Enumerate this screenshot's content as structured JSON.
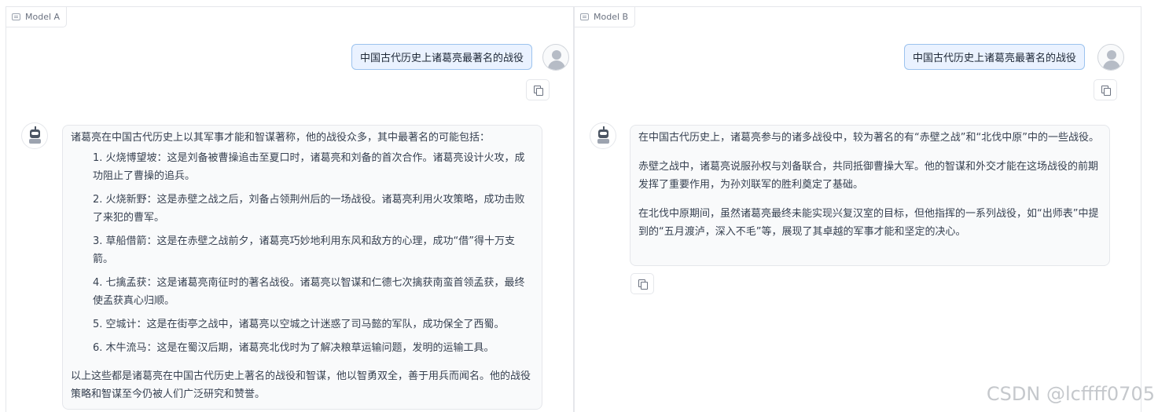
{
  "model_a": {
    "tab_label": "Model A",
    "user_message": "中国古代历史上诸葛亮最著名的战役",
    "bot_intro": "诸葛亮在中国古代历史上以其军事才能和智谋著称，他的战役众多，其中最著名的可能包括：",
    "bot_list": [
      "1. 火烧博望坡：这是刘备被曹操追击至夏口时，诸葛亮和刘备的首次合作。诸葛亮设计火攻，成功阻止了曹操的追兵。",
      "2. 火烧新野：这是赤壁之战之后，刘备占领荆州后的一场战役。诸葛亮利用火攻策略，成功击败了来犯的曹军。",
      "3. 草船借箭：这是在赤壁之战前夕，诸葛亮巧妙地利用东风和敌方的心理，成功“借”得十万支箭。",
      "4. 七擒孟获：这是诸葛亮南征时的著名战役。诸葛亮以智谋和仁德七次擒获南蛮首领孟获，最终使孟获真心归顺。",
      "5. 空城计：这是在街亭之战中，诸葛亮以空城之计迷惑了司马懿的军队，成功保全了西蜀。",
      "6. 木牛流马：这是在蜀汉后期，诸葛亮北伐时为了解决粮草运输问题，发明的运输工具。"
    ],
    "bot_outro": "以上这些都是诸葛亮在中国古代历史上著名的战役和智谋，他以智勇双全，善于用兵而闻名。他的战役策略和智谋至今仍被人们广泛研究和赞誉。"
  },
  "model_b": {
    "tab_label": "Model B",
    "user_message": "中国古代历史上诸葛亮最著名的战役",
    "bot_paragraphs": [
      "在中国古代历史上，诸葛亮参与的诸多战役中，较为著名的有“赤壁之战”和“北伐中原”中的一些战役。",
      "赤壁之战中，诸葛亮说服孙权与刘备联合，共同抵御曹操大军。他的智谋和外交才能在这场战役的前期发挥了重要作用，为孙刘联军的胜利奠定了基础。",
      "在北伐中原期间，虽然诸葛亮最终未能实现兴复汉室的目标，但他指挥的一系列战役，如“出师表”中提到的“五月渡泸，深入不毛”等，展现了其卓越的军事才能和坚定的决心。"
    ]
  },
  "watermark": "CSDN @lcffff0705",
  "icons": {
    "tab": "chat-icon",
    "user_avatar": "user-avatar-icon",
    "bot_avatar": "robot-avatar-icon",
    "copy": "copy-icon"
  }
}
